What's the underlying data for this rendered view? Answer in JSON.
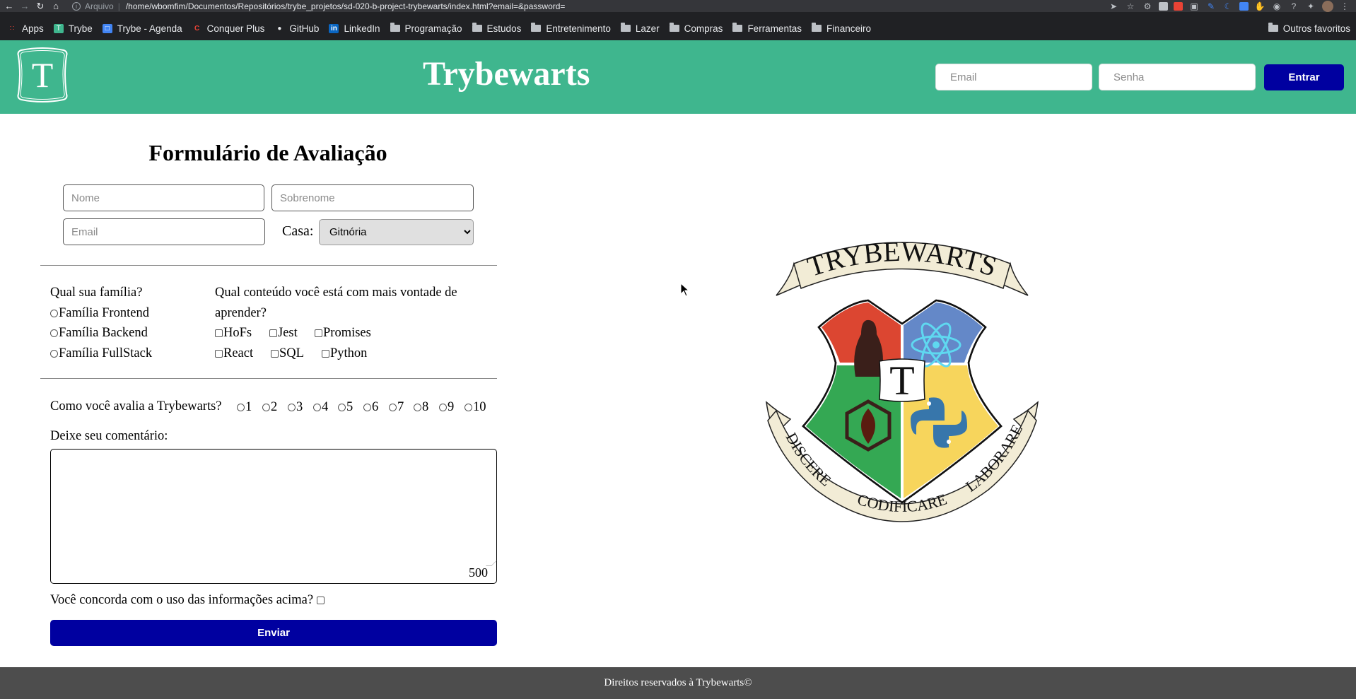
{
  "browser": {
    "url_scheme": "Arquivo",
    "url": "/home/wbomfim/Documentos/Repositórios/trybe_projetos/sd-020-b-project-trybewarts/index.html?email=&password=",
    "bookmarks": [
      {
        "label": "Apps",
        "icon": "apps-grid-icon"
      },
      {
        "label": "Trybe",
        "icon": "trybe-icon"
      },
      {
        "label": "Trybe - Agenda",
        "icon": "calendar-icon"
      },
      {
        "label": "Conquer Plus",
        "icon": "conquer-icon"
      },
      {
        "label": "GitHub",
        "icon": "github-icon"
      },
      {
        "label": "LinkedIn",
        "icon": "linkedin-icon"
      },
      {
        "label": "Programação",
        "icon": "folder-icon"
      },
      {
        "label": "Estudos",
        "icon": "folder-icon"
      },
      {
        "label": "Entretenimento",
        "icon": "folder-icon"
      },
      {
        "label": "Lazer",
        "icon": "folder-icon"
      },
      {
        "label": "Compras",
        "icon": "folder-icon"
      },
      {
        "label": "Ferramentas",
        "icon": "folder-icon"
      },
      {
        "label": "Financeiro",
        "icon": "folder-icon"
      }
    ],
    "other_bookmarks": "Outros favoritos"
  },
  "header": {
    "logo_letter": "T",
    "title": "Trybewarts",
    "email_placeholder": "Email",
    "password_placeholder": "Senha",
    "login_button": "Entrar",
    "bg_color": "#3fb68e",
    "button_color": "#0000a0"
  },
  "form": {
    "title": "Formulário de Avaliação",
    "nome_placeholder": "Nome",
    "sobrenome_placeholder": "Sobrenome",
    "email_placeholder": "Email",
    "casa_label": "Casa:",
    "casa_selected": "Gitnória",
    "familia_question": "Qual sua família?",
    "familias": [
      "Família Frontend",
      "Família Backend",
      "Família FullStack"
    ],
    "conteudo_question": "Qual conteúdo você está com mais vontade de aprender?",
    "conteudos_row1": [
      "HoFs",
      "Jest",
      "Promises"
    ],
    "conteudos_row2": [
      "React",
      "SQL",
      "Python"
    ],
    "avalia_question": "Como você avalia a Trybewarts?",
    "ratings": [
      "1",
      "2",
      "3",
      "4",
      "5",
      "6",
      "7",
      "8",
      "9",
      "10"
    ],
    "comment_label": "Deixe seu comentário:",
    "char_counter": "500",
    "agreement_label": "Você concorda com o uso das informações acima?",
    "submit_button": "Enviar"
  },
  "crest": {
    "top_banner": "TRYBEWARTS",
    "center_letter": "T",
    "left_motto": "DISCERE",
    "bottom_motto": "CODIFICARE",
    "right_motto": "LABORARE"
  },
  "footer": {
    "text": "Direitos reservados à Trybewarts©"
  }
}
